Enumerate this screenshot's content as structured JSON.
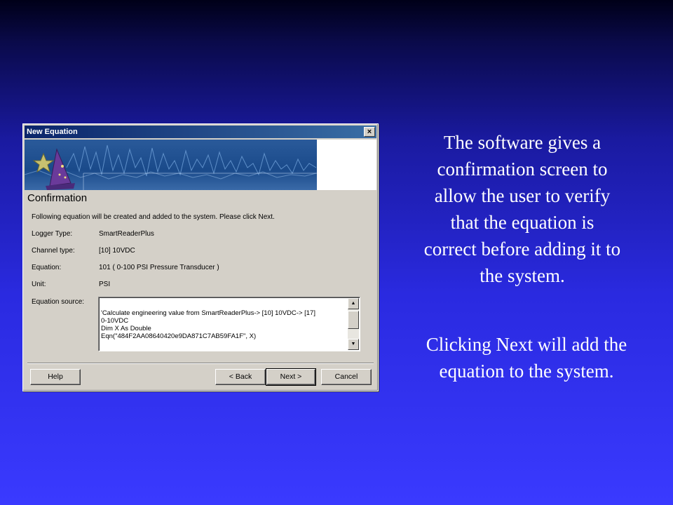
{
  "dialog": {
    "title": "New Equation",
    "close_glyph": "×",
    "heading": "Confirmation",
    "instruction": "Following equation will be created and added to the system. Please click Next.",
    "fields": [
      {
        "label": "Logger Type:",
        "value": "SmartReaderPlus"
      },
      {
        "label": "Channel type:",
        "value": "[10] 10VDC"
      },
      {
        "label": "Equation:",
        "value": "101 ( 0-100 PSI Pressure Transducer )"
      },
      {
        "label": "Unit:",
        "value": "PSI"
      }
    ],
    "source_label": "Equation source:",
    "source_lines": [
      "'Calculate engineering value from SmartReaderPlus-> [10] 10VDC-> [17]",
      "0-10VDC",
      "Dim X As Double",
      "Eqn(\"484F2AA08640420e9DA871C7AB59FA1F\", X)"
    ],
    "scroll_up_glyph": "▲",
    "scroll_down_glyph": "▼",
    "buttons": {
      "help": "Help",
      "back": "< Back",
      "next": "Next >",
      "cancel": "Cancel"
    },
    "wizard_icon": "wizard-hat-icon"
  },
  "captions": {
    "paragraph1": [
      "The software gives a",
      "confirmation screen to",
      "allow the user to verify",
      "that the equation is",
      "correct before adding it to",
      "the system."
    ],
    "paragraph2": [
      "Clicking Next will add the",
      "equation to the system."
    ]
  },
  "colors": {
    "titlebar_start": "#0a246a",
    "titlebar_end": "#3a6ea5",
    "dialog_face": "#d4d0c8",
    "caption_text": "#ffffff"
  }
}
